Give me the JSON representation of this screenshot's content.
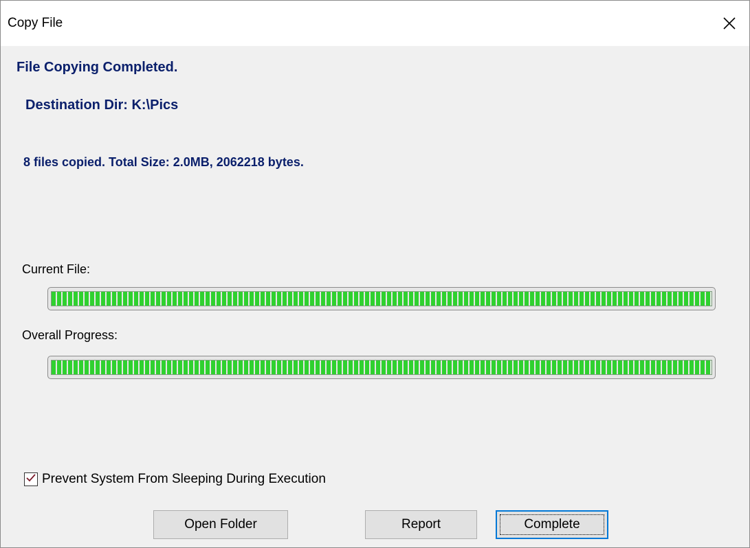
{
  "window": {
    "title": "Copy File"
  },
  "status": {
    "headline": "File Copying Completed.",
    "destination": "Destination Dir: K:\\Pics",
    "summary": "8 files copied. Total Size: 2.0MB, 2062218 bytes."
  },
  "progress": {
    "current_file_label": "Current File:",
    "current_file_percent": 100,
    "overall_label": "Overall Progress:",
    "overall_percent": 100,
    "bar_color": "#2fd12f"
  },
  "options": {
    "prevent_sleep_label": "Prevent System From Sleeping During Execution",
    "prevent_sleep_checked": true
  },
  "buttons": {
    "open_folder": "Open Folder",
    "report": "Report",
    "complete": "Complete"
  },
  "icons": {
    "close": "close-icon",
    "check": "checkmark-icon"
  }
}
